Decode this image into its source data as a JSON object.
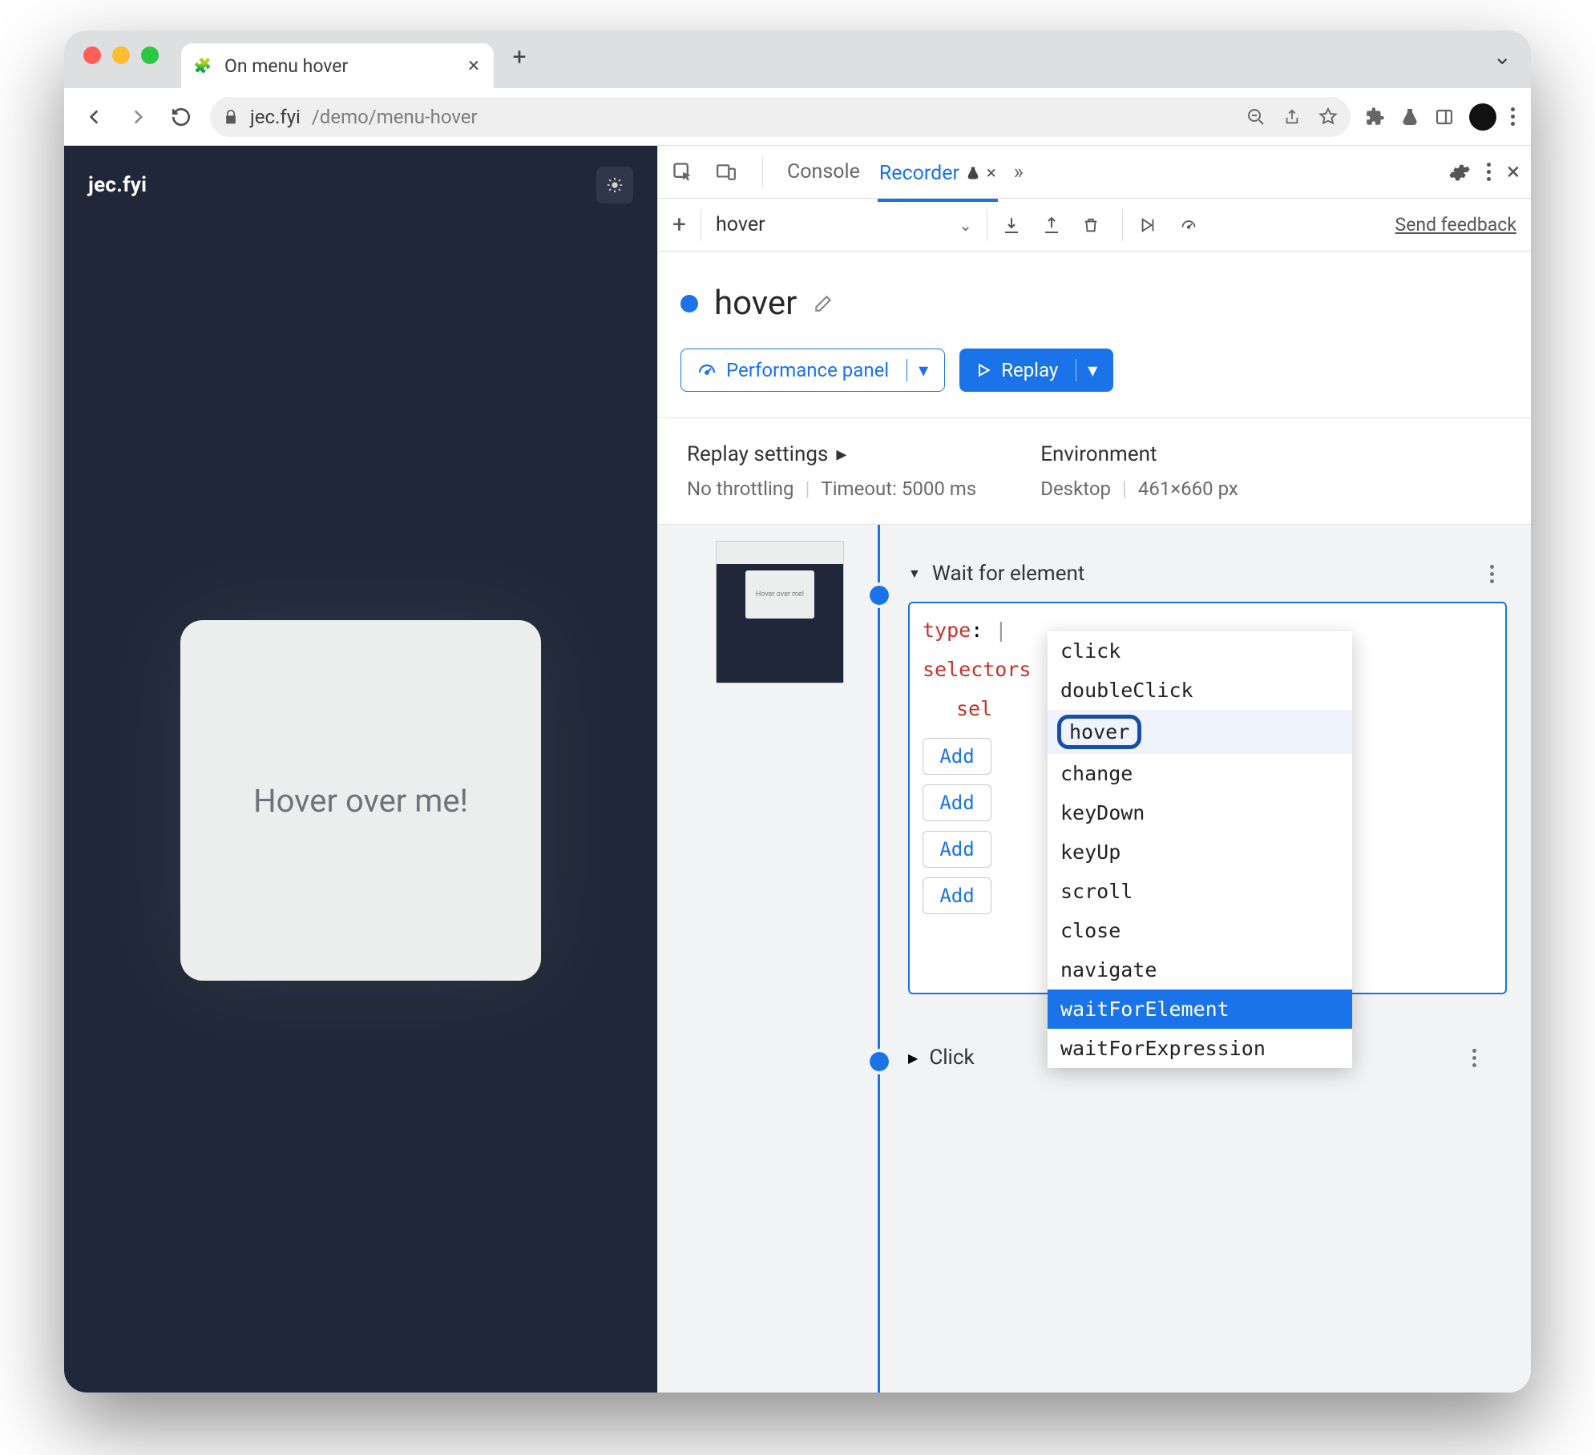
{
  "browser": {
    "tab_title": "On menu hover",
    "url_host": "jec.fyi",
    "url_path": "/demo/menu-hover"
  },
  "page": {
    "brand": "jec.fyi",
    "hover_text": "Hover over me!",
    "thumb_text": "Hover over me!"
  },
  "devtools": {
    "tabs": {
      "console": "Console",
      "recorder": "Recorder"
    },
    "recorder": {
      "toolbar_name": "hover",
      "feedback": "Send feedback",
      "title": "hover",
      "perf_btn": "Performance panel",
      "replay_btn": "Replay",
      "replay_settings_label": "Replay settings",
      "throttling": "No throttling",
      "timeout": "Timeout: 5000 ms",
      "environment_label": "Environment",
      "env_device": "Desktop",
      "env_viewport": "461×660 px"
    },
    "step": {
      "title": "Wait for element",
      "type_key": "type",
      "selectors_key": "selectors",
      "sel_key": "sel",
      "add_label": "Add"
    },
    "suggestions": [
      "click",
      "doubleClick",
      "hover",
      "change",
      "keyDown",
      "keyUp",
      "scroll",
      "close",
      "navigate",
      "waitForElement",
      "waitForExpression"
    ],
    "step2_title": "Click"
  }
}
